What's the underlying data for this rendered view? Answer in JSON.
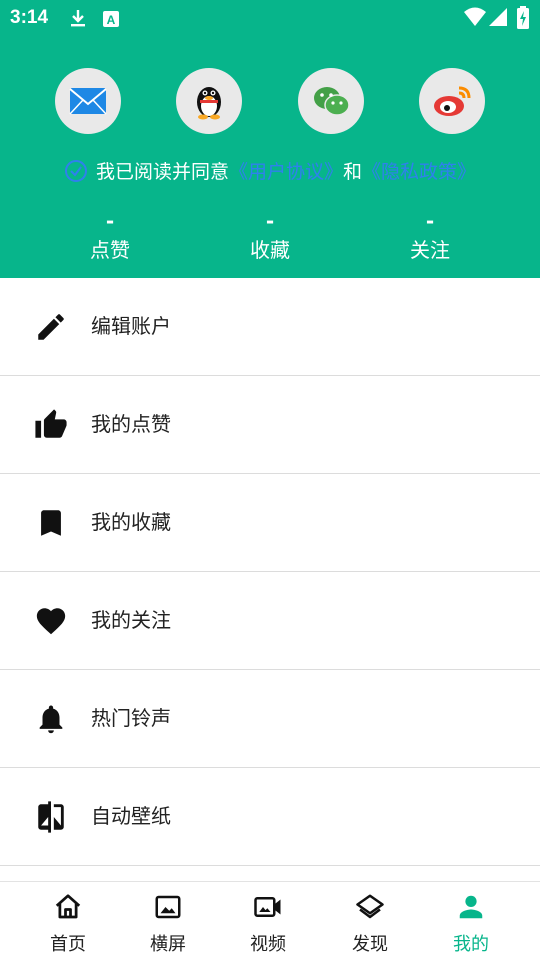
{
  "status_bar": {
    "time": "3:14",
    "icons": [
      "download-icon",
      "a-icon",
      "wifi-icon",
      "signal-icon",
      "battery-icon"
    ]
  },
  "header": {
    "bg_color": "#07B58B",
    "login_buttons": [
      {
        "name": "email",
        "icon": "mail-icon"
      },
      {
        "name": "qq",
        "icon": "qq-icon"
      },
      {
        "name": "wechat",
        "icon": "wechat-icon"
      },
      {
        "name": "weibo",
        "icon": "weibo-icon"
      }
    ],
    "agreement": {
      "prefix": "我已阅读并同意",
      "user_agreement": "《用户协议》",
      "and": "和",
      "privacy_policy": "《隐私政策》",
      "checked": true
    },
    "stats": [
      {
        "value": "-",
        "label": "点赞"
      },
      {
        "value": "-",
        "label": "收藏"
      },
      {
        "value": "-",
        "label": "关注"
      }
    ]
  },
  "menu": {
    "items": [
      {
        "label": "编辑账户",
        "icon": "pencil-icon"
      },
      {
        "label": "我的点赞",
        "icon": "thumbs-up-icon"
      },
      {
        "label": "我的收藏",
        "icon": "bookmark-icon"
      },
      {
        "label": "我的关注",
        "icon": "heart-icon"
      },
      {
        "label": "热门铃声",
        "icon": "bell-icon"
      },
      {
        "label": "自动壁纸",
        "icon": "compare-icon"
      }
    ]
  },
  "bottom_nav": {
    "active_color": "#07B58B",
    "items": [
      {
        "label": "首页",
        "icon": "home-icon",
        "active": false
      },
      {
        "label": "横屏",
        "icon": "image-icon",
        "active": false
      },
      {
        "label": "视频",
        "icon": "video-icon",
        "active": false
      },
      {
        "label": "发现",
        "icon": "layers-icon",
        "active": false
      },
      {
        "label": "我的",
        "icon": "person-icon",
        "active": true
      }
    ]
  }
}
